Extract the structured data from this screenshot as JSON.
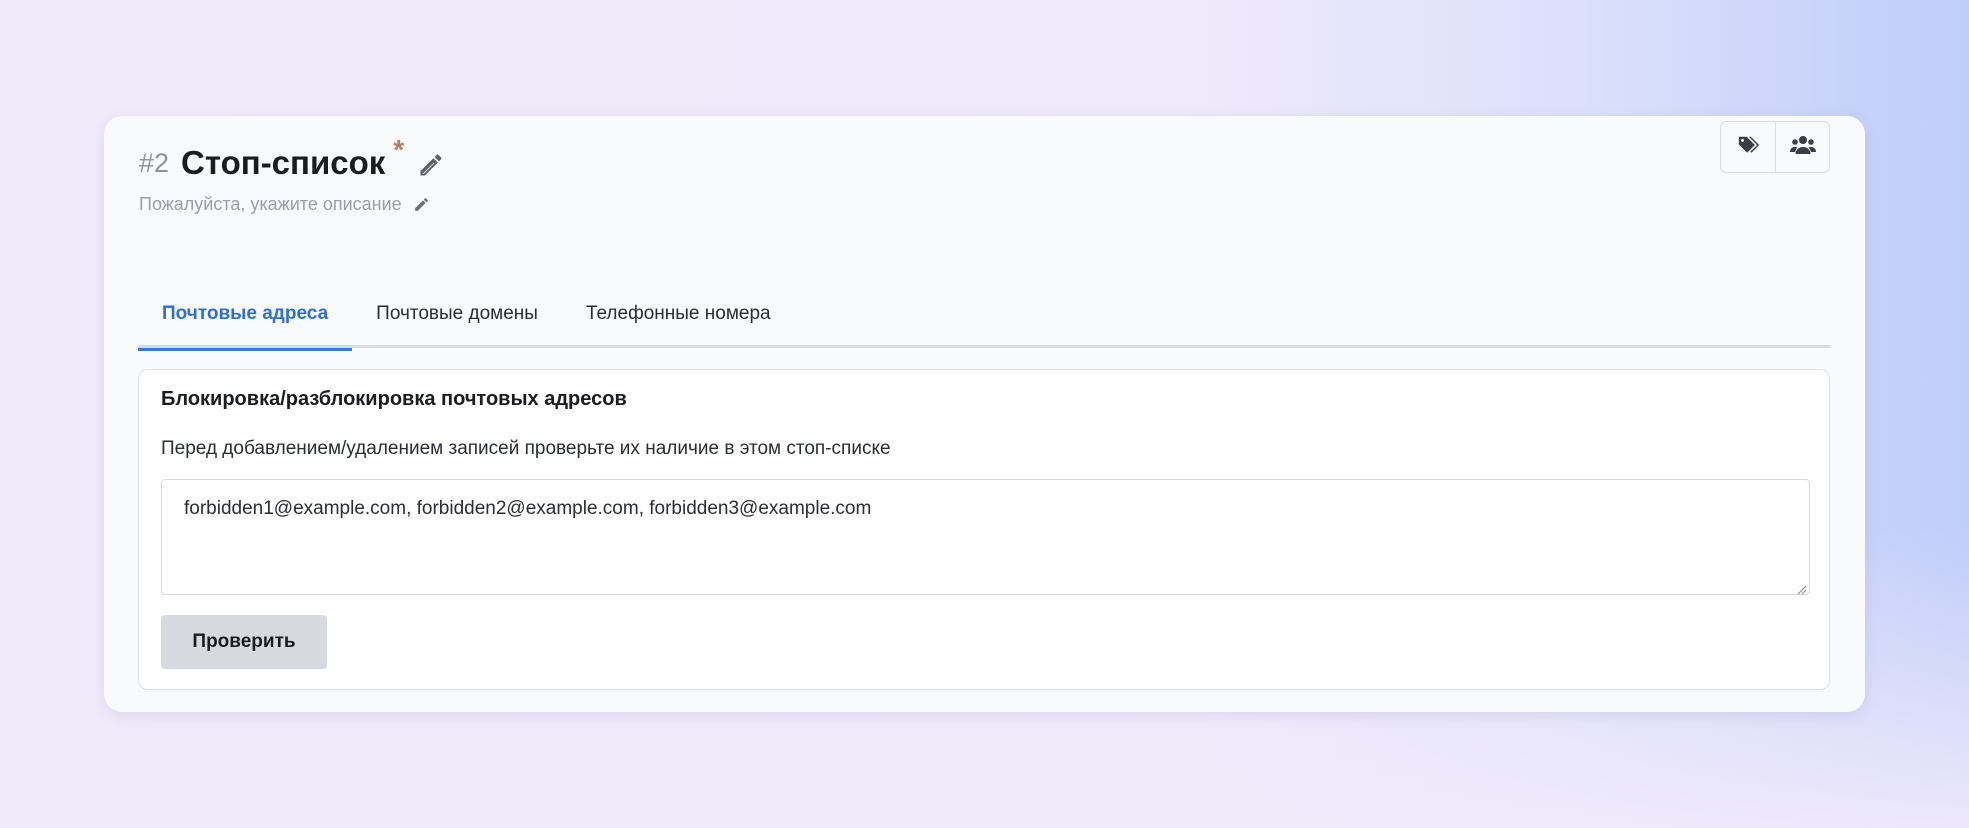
{
  "header": {
    "number": "#2",
    "title": "Стоп-список",
    "required_mark": "*",
    "description_placeholder": "Пожалуйста, укажите описание"
  },
  "toolbar": {
    "buttons": [
      {
        "icon": "tags-icon"
      },
      {
        "icon": "users-icon"
      }
    ]
  },
  "tabs": [
    {
      "label": "Почтовые адреса",
      "active": true
    },
    {
      "label": "Почтовые домены",
      "active": false
    },
    {
      "label": "Телефонные номера",
      "active": false
    }
  ],
  "panel": {
    "title": "Блокировка/разблокировка почтовых адресов",
    "hint": "Перед добавлением/удалением записей проверьте их наличие в этом стоп-списке",
    "textarea_value": "forbidden1@example.com, forbidden2@example.com, forbidden3@example.com",
    "check_button_label": "Проверить"
  },
  "colors": {
    "accent": "#3778d8",
    "required_star": "#b08057",
    "button_bg": "#d6d9e0"
  }
}
